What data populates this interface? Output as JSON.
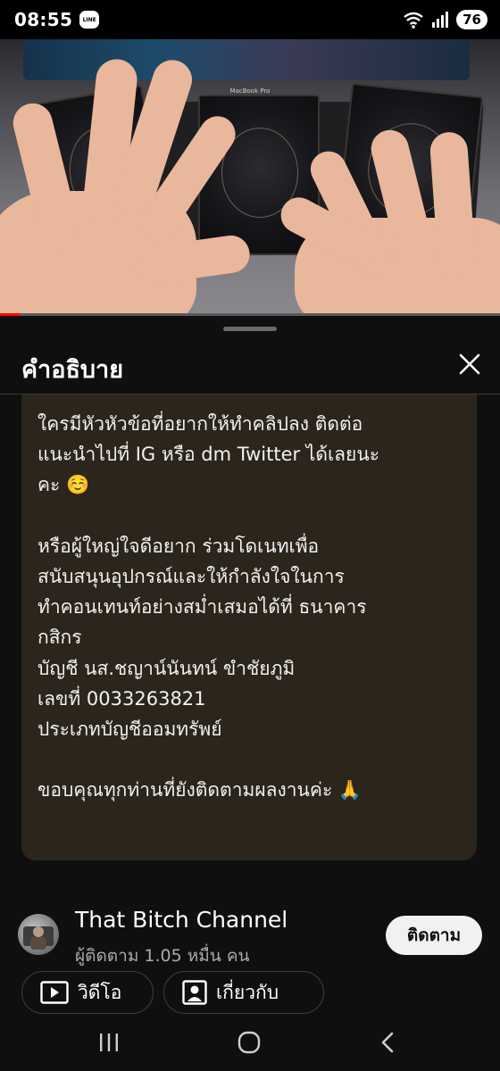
{
  "status_bar": {
    "time": "08:55",
    "line_badge": "LINE",
    "battery": "76"
  },
  "video": {
    "laptop_brand": "MacBook Pro",
    "progress_fraction": 0.04
  },
  "sheet": {
    "title": "คำอธิบาย",
    "description_lines": [
      "ใครมีหัวหัวข้อที่อยากให้ทำคลิปลง ติดต่อ",
      "แนะนำไปที่ IG หรือ dm Twitter ได้เลยนะ",
      "คะ ☺️",
      "",
      "หรือผู้ใหญ่ใจดีอยาก ร่วมโดเนทเพื่อ",
      "สนับสนุนอุปกรณ์และให้กำลังใจในการ",
      "ทำคอนเทนท์อย่างสม่ำเสมอได้ที่ ธนาคาร",
      "กสิกร",
      "บัญชี นส.ชญาน์นันทน์ ขำชัยภูมิ",
      "เลขที่ 0033263821",
      "ประเภทบัญชีออมทรัพย์",
      "",
      "ขอบคุณทุกท่านที่ยังติดตามผลงานค่ะ 🙏"
    ]
  },
  "channel": {
    "name": "That Bitch Channel",
    "subscribers_prefix": "ผู้ติดตาม",
    "subscribers_count": "1.05",
    "subscribers_suffix": "หมื่น คน",
    "subscribe_label": "ติดตาม"
  },
  "buttons": {
    "videos_label": "วิดีโอ",
    "about_label": "เกี่ยวกับ"
  },
  "colors": {
    "description_bg": "#2b251c",
    "progress": "#ff0000"
  }
}
